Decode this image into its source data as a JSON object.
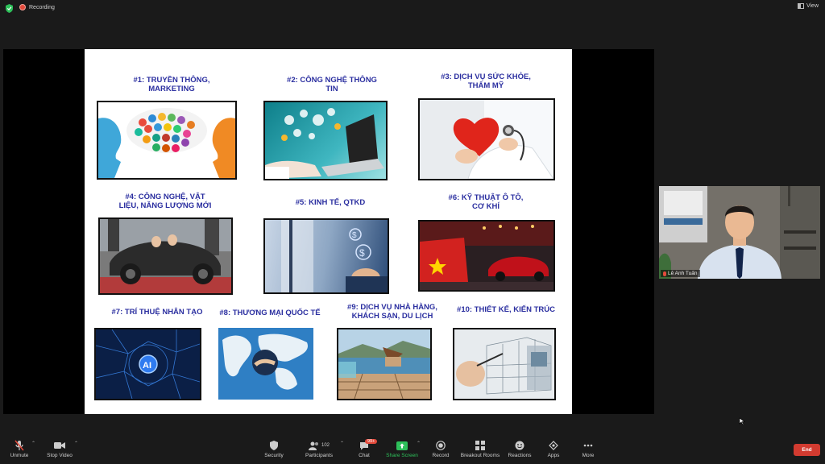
{
  "topbar": {
    "recording": "Recording",
    "view": "View"
  },
  "slide": {
    "items": [
      {
        "label": "#1: TRUYỀN THÔNG,\nMARKETING"
      },
      {
        "label": "#2: CÔNG NGHỆ THÔNG\nTIN"
      },
      {
        "label": "#3: DỊCH VỤ SỨC KHỎE,\nTHẨM MỸ"
      },
      {
        "label": "#4: CÔNG NGHỆ, VẬT\nLIỆU, NĂNG LƯỢNG MỚI"
      },
      {
        "label": "#5: KINH TẾ, QTKD"
      },
      {
        "label": "#6: KỸ THUẬT Ô TÔ,\nCƠ KHÍ"
      },
      {
        "label": "#7: TRÍ THUỆ NHÂN TẠO"
      },
      {
        "label": "#8: THƯƠNG MẠI QUỐC TẾ"
      },
      {
        "label": "#9: DỊCH VỤ NHÀ HÀNG,\nKHÁCH SẠN, DU LỊCH"
      },
      {
        "label": "#10: THIẾT KẾ, KIẾN TRÚC"
      }
    ],
    "ai_text": "AI"
  },
  "camera": {
    "name": "Lê Anh Tuấn"
  },
  "toolbar": {
    "unmute": "Unmute",
    "stop_video": "Stop Video",
    "security": "Security",
    "participants": "Participants",
    "participants_count": "102",
    "chat": "Chat",
    "chat_badge": "99+",
    "share_screen": "Share Screen",
    "record": "Record",
    "breakout": "Breakout Rooms",
    "reactions": "Reactions",
    "apps": "Apps",
    "more": "More",
    "end": "End"
  },
  "colors": {
    "caption": "#2b2fa0",
    "end": "#d23b30",
    "share_green": "#2dc05a"
  }
}
